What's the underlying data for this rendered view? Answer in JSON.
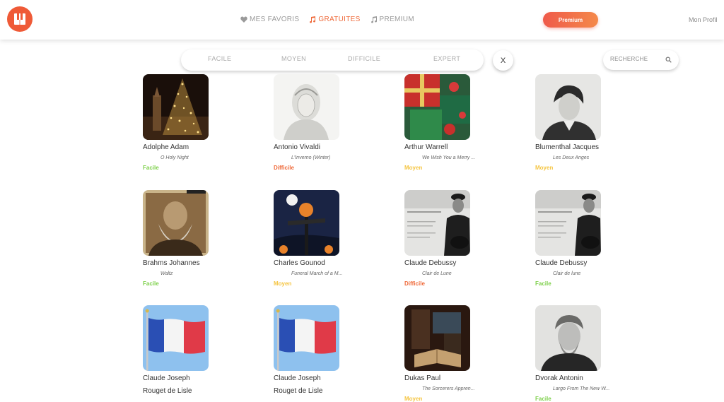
{
  "nav": {
    "favorites": "MES FAVORIS",
    "free": "GRATUITES",
    "premium": "PREMIUM"
  },
  "premium_button": "Premium",
  "profile": "Mon Profil",
  "filters": [
    "FACILE",
    "MOYEN",
    "DIFFICILE",
    "EXPERT"
  ],
  "close_label": "X",
  "search": {
    "placeholder": "RECHERCHE"
  },
  "colors": {
    "facile": "#7ed04b",
    "moyen": "#f5c542",
    "difficile": "#ef6a3a",
    "accent": "#ef5a37"
  },
  "cards": [
    {
      "composer": "Adolphe Adam",
      "piece": "O Holy Night",
      "level": "Facile",
      "level_key": "facile",
      "image": "christmas-tree-night"
    },
    {
      "composer": "Antonio Vivaldi",
      "piece": "L'Inverno (Winter)",
      "level": "Difficile",
      "level_key": "difficile",
      "image": "vivaldi-portrait"
    },
    {
      "composer": "Arthur Warrell",
      "piece": "We Wish You a Merry ...",
      "level": "Moyen",
      "level_key": "moyen",
      "image": "christmas-gifts"
    },
    {
      "composer": "Blumenthal Jacques",
      "piece": "Les Deux Anges",
      "level": "Moyen",
      "level_key": "moyen",
      "image": "blumenthal-portrait"
    },
    {
      "composer": "Brahms Johannes",
      "piece": "Waltz",
      "level": "Facile",
      "level_key": "facile",
      "image": "brahms-cover"
    },
    {
      "composer": "Charles Gounod",
      "piece": "Funeral March of a M...",
      "level": "Moyen",
      "level_key": "moyen",
      "image": "halloween-scarecrow"
    },
    {
      "composer": "Claude Debussy",
      "piece": "Clair de Lune",
      "level": "Difficile",
      "level_key": "difficile",
      "image": "debussy-cover"
    },
    {
      "composer": "Claude Debussy",
      "piece": "Clair de lune",
      "level": "Facile",
      "level_key": "facile",
      "image": "debussy-cover"
    },
    {
      "composer": "Claude Joseph",
      "composer_line2": "Rouget de Lisle",
      "image": "french-flag"
    },
    {
      "composer": "Claude Joseph",
      "composer_line2": "Rouget de Lisle",
      "image": "french-flag"
    },
    {
      "composer": "Dukas Paul",
      "piece": "The Sorcerers Appren...",
      "level": "Moyen",
      "level_key": "moyen",
      "image": "sorcerer-book"
    },
    {
      "composer": "Dvorak Antonin",
      "piece": "Largo From The New W...",
      "level": "Facile",
      "level_key": "facile",
      "image": "dvorak-portrait"
    }
  ]
}
